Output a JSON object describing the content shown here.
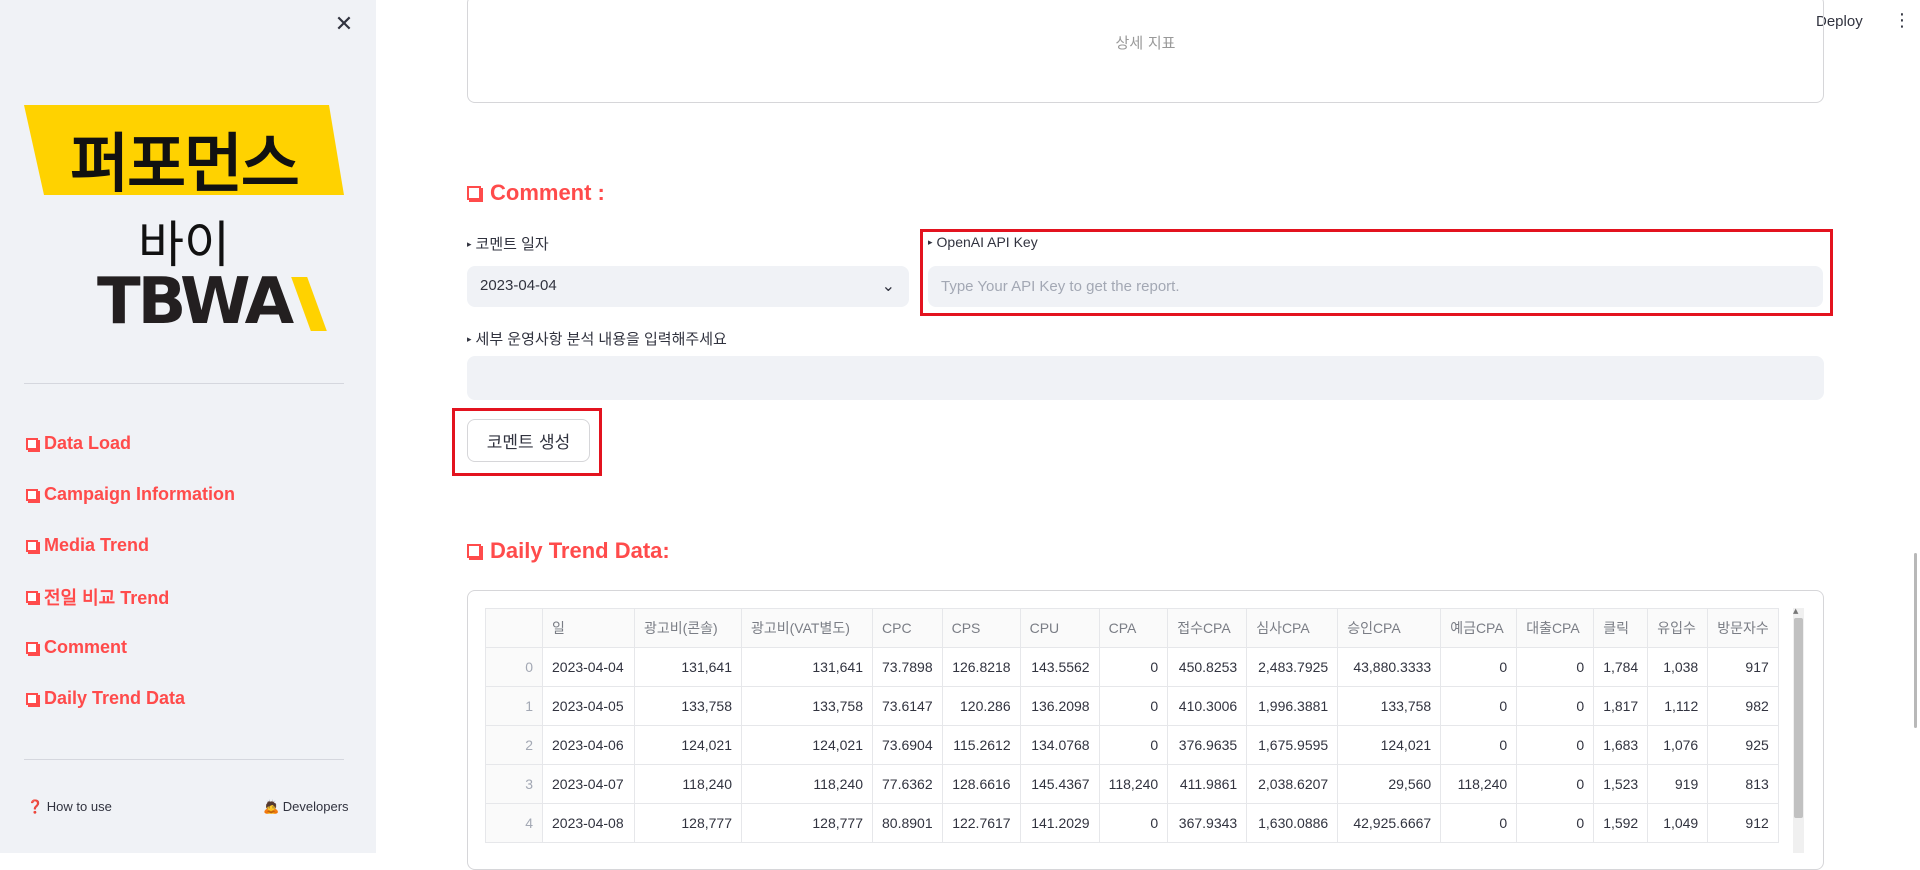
{
  "sidebar": {
    "logo": {
      "top": "퍼포먼스",
      "middle": "바이",
      "brand": "TBWA"
    },
    "nav": [
      {
        "label": "Data Load"
      },
      {
        "label": "Campaign Information"
      },
      {
        "label": "Media Trend"
      },
      {
        "label": "전일 비교 Trend"
      },
      {
        "label": "Comment"
      },
      {
        "label": "Daily Trend Data"
      }
    ],
    "footer": {
      "how_to_use": "❓ How to use",
      "developers": "🙇 Developers"
    }
  },
  "header": {
    "deploy": "Deploy"
  },
  "top_box": {
    "text": "상세 지표"
  },
  "comment": {
    "title": "Comment :",
    "date_label": "코멘트 일자",
    "date_value": "2023-04-04",
    "api_label": "OpenAI API Key",
    "api_placeholder": "Type Your API Key to get the report.",
    "detail_label": "세부 운영사항 분석 내용을 입력해주세요",
    "button": "코멘트 생성"
  },
  "daily": {
    "title": "Daily Trend Data:",
    "columns": [
      "",
      "일",
      "광고비(콘솔)",
      "광고비(VAT별도)",
      "CPC",
      "CPS",
      "CPU",
      "CPA",
      "접수CPA",
      "심사CPA",
      "승인CPA",
      "예금CPA",
      "대출CPA",
      "클릭",
      "유입수",
      "방문자수"
    ],
    "rows": [
      [
        "0",
        "2023-04-04",
        "131,641",
        "131,641",
        "73.7898",
        "126.8218",
        "143.5562",
        "0",
        "450.8253",
        "2,483.7925",
        "43,880.3333",
        "0",
        "0",
        "1,784",
        "1,038",
        "917"
      ],
      [
        "1",
        "2023-04-05",
        "133,758",
        "133,758",
        "73.6147",
        "120.286",
        "136.2098",
        "0",
        "410.3006",
        "1,996.3881",
        "133,758",
        "0",
        "0",
        "1,817",
        "1,112",
        "982"
      ],
      [
        "2",
        "2023-04-06",
        "124,021",
        "124,021",
        "73.6904",
        "115.2612",
        "134.0768",
        "0",
        "376.9635",
        "1,675.9595",
        "124,021",
        "0",
        "0",
        "1,683",
        "1,076",
        "925"
      ],
      [
        "3",
        "2023-04-07",
        "118,240",
        "118,240",
        "77.6362",
        "128.6616",
        "145.4367",
        "118,240",
        "411.9861",
        "2,038.6207",
        "29,560",
        "118,240",
        "0",
        "1,523",
        "919",
        "813"
      ],
      [
        "4",
        "2023-04-08",
        "128,777",
        "128,777",
        "80.8901",
        "122.7617",
        "141.2029",
        "0",
        "367.9343",
        "1,630.0886",
        "42,925.6667",
        "0",
        "0",
        "1,592",
        "1,049",
        "912"
      ]
    ]
  }
}
